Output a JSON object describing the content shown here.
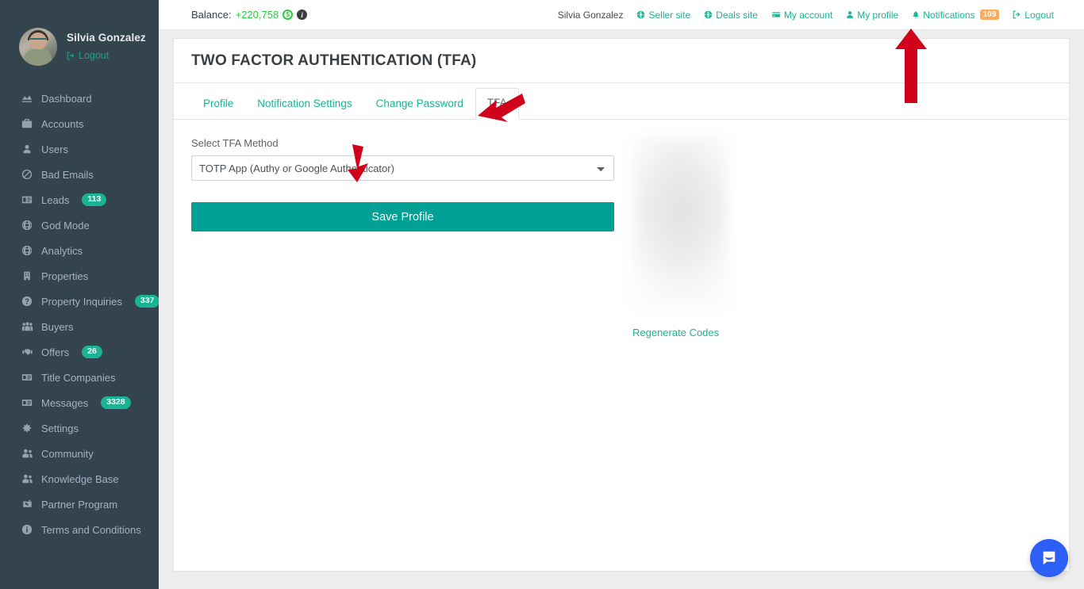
{
  "sidebar": {
    "profile": {
      "name": "Silvia Gonzalez",
      "logout_label": "Logout",
      "avatar_icon": "user-avatar-photo"
    },
    "items": [
      {
        "label": "Dashboard",
        "icon": "chart-area-icon",
        "badge": null
      },
      {
        "label": "Accounts",
        "icon": "briefcase-icon",
        "badge": null
      },
      {
        "label": "Users",
        "icon": "user-icon",
        "badge": null
      },
      {
        "label": "Bad Emails",
        "icon": "ban-icon",
        "badge": null
      },
      {
        "label": "Leads",
        "icon": "id-card-icon",
        "badge": "113"
      },
      {
        "label": "God Mode",
        "icon": "globe-icon",
        "badge": null
      },
      {
        "label": "Analytics",
        "icon": "globe-icon",
        "badge": null
      },
      {
        "label": "Properties",
        "icon": "building-icon",
        "badge": null
      },
      {
        "label": "Property Inquiries",
        "icon": "question-circle-icon",
        "badge": "337"
      },
      {
        "label": "Buyers",
        "icon": "users-group-icon",
        "badge": null
      },
      {
        "label": "Offers",
        "icon": "handshake-icon",
        "badge": "26"
      },
      {
        "label": "Title Companies",
        "icon": "address-card-icon",
        "badge": null
      },
      {
        "label": "Messages",
        "icon": "address-card-icon",
        "badge": "3328"
      },
      {
        "label": "Settings",
        "icon": "gear-icon",
        "badge": null
      },
      {
        "label": "Community",
        "icon": "user-friends-icon",
        "badge": null
      },
      {
        "label": "Knowledge Base",
        "icon": "user-friends-icon",
        "badge": null
      },
      {
        "label": "Partner Program",
        "icon": "handshake-alt-icon",
        "badge": null
      },
      {
        "label": "Terms and Conditions",
        "icon": "info-circle-icon",
        "badge": null
      }
    ]
  },
  "topbar": {
    "balance_label": "Balance:",
    "balance_amount": "+220,758",
    "coin_icon": "coin-icon",
    "info_icon": "info-icon",
    "user_name": "Silvia Gonzalez",
    "links": [
      {
        "label": "Seller site",
        "icon": "globe-icon"
      },
      {
        "label": "Deals site",
        "icon": "globe-icon"
      },
      {
        "label": "My account",
        "icon": "credit-card-icon"
      },
      {
        "label": "My profile",
        "icon": "user-icon"
      },
      {
        "label": "Notifications",
        "icon": "bell-icon",
        "badge": "109"
      },
      {
        "label": "Logout",
        "icon": "sign-out-icon"
      }
    ]
  },
  "main": {
    "page_title": "TWO FACTOR AUTHENTICATION (TFA)",
    "tabs": [
      {
        "label": "Profile",
        "active": false
      },
      {
        "label": "Notification Settings",
        "active": false
      },
      {
        "label": "Change Password",
        "active": false
      },
      {
        "label": "TFA",
        "active": true
      }
    ],
    "form": {
      "select_label": "Select TFA Method",
      "select_value": "TOTP App (Authy or Google Authenticator)",
      "select_options": [
        "TOTP App (Authy or Google Authenticator)"
      ],
      "save_button": "Save Profile"
    },
    "qr": {
      "image_name": "tfa-qr-code-blurred",
      "regenerate_label": "Regenerate Codes"
    }
  },
  "annotations": {
    "arrow_color": "#d0021b",
    "arrows": [
      {
        "name": "arrow-pointing-my-profile",
        "direction": "up"
      },
      {
        "name": "arrow-pointing-tfa-tab",
        "direction": "down-left"
      },
      {
        "name": "arrow-pointing-tfa-select",
        "direction": "down"
      }
    ]
  },
  "widgets": {
    "intercom": {
      "icon": "intercom-chat-icon",
      "color": "#2c5ff6"
    }
  },
  "colors": {
    "sidebar_bg": "#33444f",
    "accent_teal": "#1ab394",
    "button_teal": "#00a094",
    "badge_teal": "#1ab394",
    "badge_amber": "#f8ac59",
    "page_bg": "#ededed",
    "balance_green": "#2ecc40"
  }
}
